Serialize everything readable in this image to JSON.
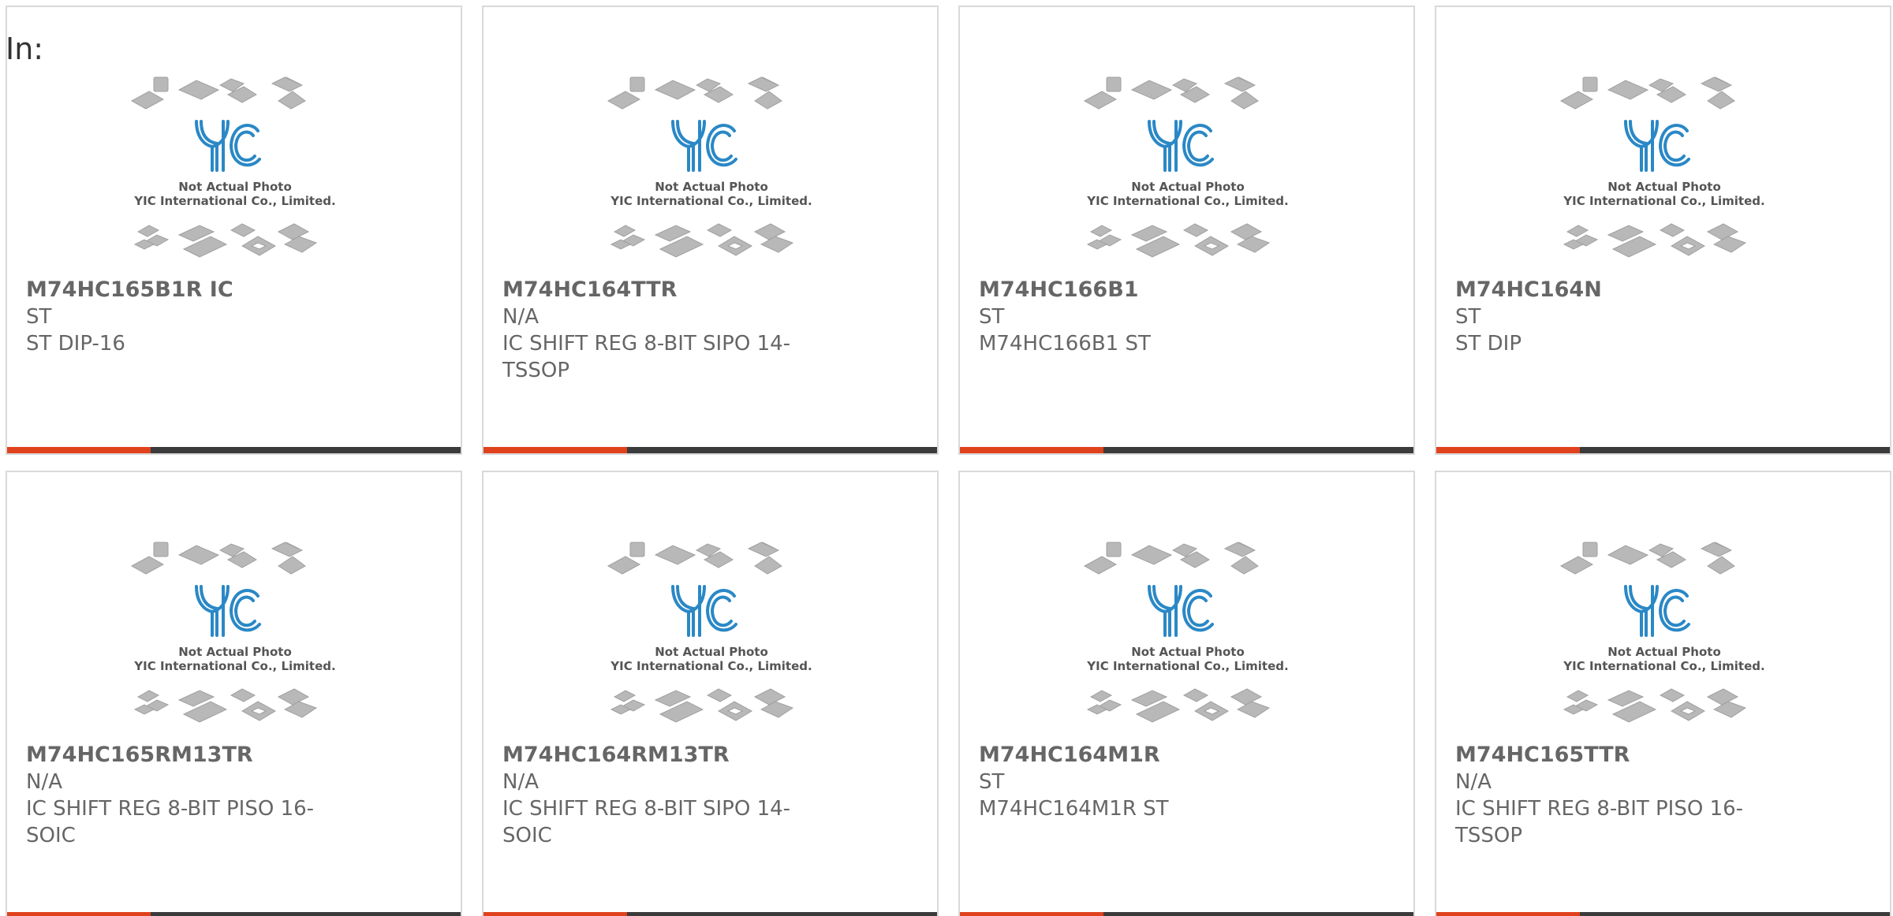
{
  "heading": "In:",
  "colors": {
    "accent": "#e0421d",
    "bar_dark": "#3b3b3b",
    "logo_blue": "#2a88c6",
    "chip_gray": "#b5b5b5",
    "text": "#666666"
  },
  "photo": {
    "logo_text": "YIC",
    "caption_line1": "Not Actual Photo",
    "caption_line2": "YIC International Co., Limited."
  },
  "products": [
    {
      "part": "M74HC165B1R IC",
      "maker": "ST",
      "desc": "ST DIP-16"
    },
    {
      "part": "M74HC164TTR",
      "maker": "N/A",
      "desc": "IC SHIFT REG 8-BIT SIPO 14-TSSOP"
    },
    {
      "part": "M74HC166B1",
      "maker": "ST",
      "desc": "M74HC166B1 ST"
    },
    {
      "part": "M74HC164N",
      "maker": "ST",
      "desc": "ST DIP"
    },
    {
      "part": "M74HC165RM13TR",
      "maker": "N/A",
      "desc": "IC SHIFT REG 8-BIT PISO 16-SOIC"
    },
    {
      "part": "M74HC164RM13TR",
      "maker": "N/A",
      "desc": "IC SHIFT REG 8-BIT SIPO 14-SOIC"
    },
    {
      "part": "M74HC164M1R",
      "maker": "ST",
      "desc": "M74HC164M1R ST"
    },
    {
      "part": "M74HC165TTR",
      "maker": "N/A",
      "desc": "IC SHIFT REG 8-BIT PISO 16-TSSOP"
    }
  ]
}
